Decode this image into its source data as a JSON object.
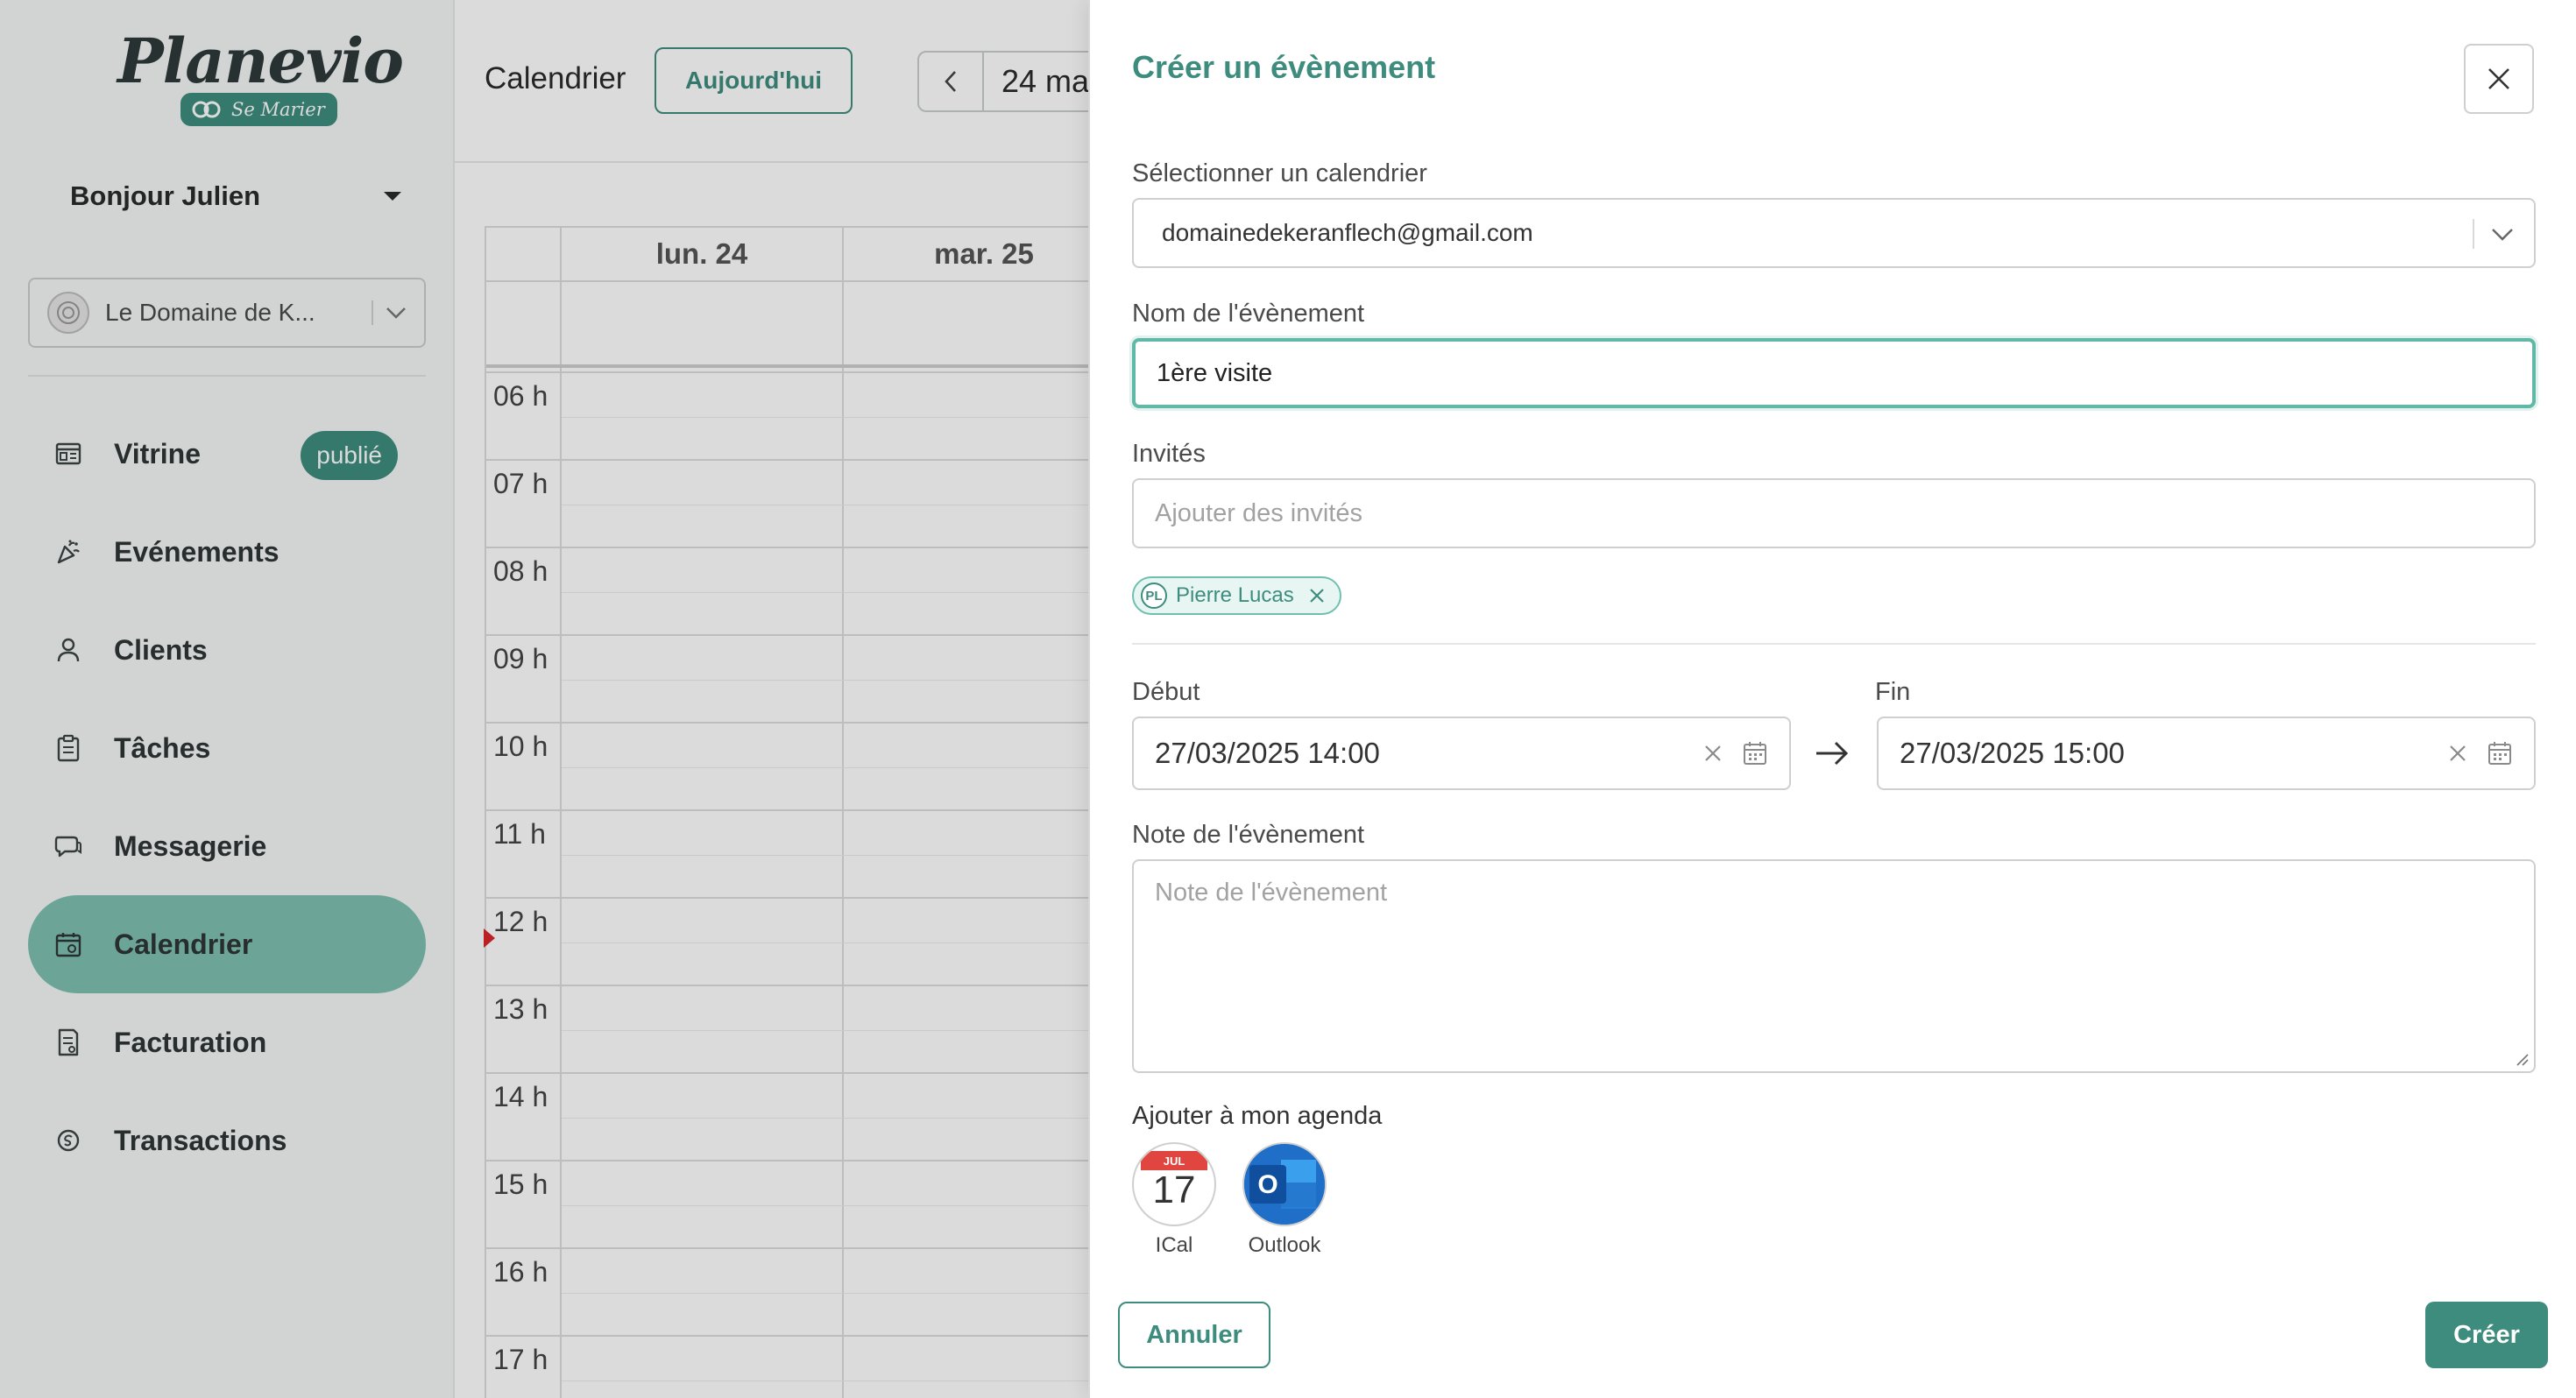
{
  "brand": {
    "logo_text": "Planevio",
    "logo_sub": "Se Marier",
    "color_primary": "#3e8c7e",
    "color_active_nav": "#7ec1b2"
  },
  "sidebar": {
    "greeting": "Bonjour Julien",
    "venue": "Le Domaine de K...",
    "items": [
      {
        "label": "Vitrine",
        "icon": "storefront-icon",
        "badge": "publié"
      },
      {
        "label": "Evénements",
        "icon": "party-popper-icon"
      },
      {
        "label": "Clients",
        "icon": "user-icon"
      },
      {
        "label": "Tâches",
        "icon": "clipboard-icon"
      },
      {
        "label": "Messagerie",
        "icon": "chat-icon"
      },
      {
        "label": "Calendrier",
        "icon": "calendar-icon",
        "active": true
      },
      {
        "label": "Facturation",
        "icon": "invoice-icon"
      },
      {
        "label": "Transactions",
        "icon": "coin-icon"
      }
    ]
  },
  "calendar": {
    "title": "Calendrier",
    "today_button": "Aujourd'hui",
    "range": "24 ma",
    "days": [
      "lun. 24",
      "mar. 25"
    ],
    "hours": [
      "06 h",
      "07 h",
      "08 h",
      "09 h",
      "10 h",
      "11 h",
      "12 h",
      "13 h",
      "14 h",
      "15 h",
      "16 h",
      "17 h"
    ]
  },
  "drawer": {
    "title": "Créer un évènement",
    "calendar_label": "Sélectionner un calendrier",
    "calendar_value": "domainedekeranflech@gmail.com",
    "event_name_label": "Nom de l'évènement",
    "event_name_value": "1ère visite",
    "guests_label": "Invités",
    "guests_placeholder": "Ajouter des invités",
    "guest_chips": [
      {
        "initials": "PL",
        "name": "Pierre Lucas"
      }
    ],
    "start_label": "Début",
    "start_value": "27/03/2025 14:00",
    "end_label": "Fin",
    "end_value": "27/03/2025 15:00",
    "note_label": "Note de l'évènement",
    "note_placeholder": "Note de l'évènement",
    "agenda_label": "Ajouter à mon agenda",
    "agenda_apps": [
      {
        "name": "ICal",
        "month": "JUL",
        "day": "17"
      },
      {
        "name": "Outlook",
        "letter": "O"
      }
    ],
    "cancel_button": "Annuler",
    "create_button": "Créer"
  }
}
